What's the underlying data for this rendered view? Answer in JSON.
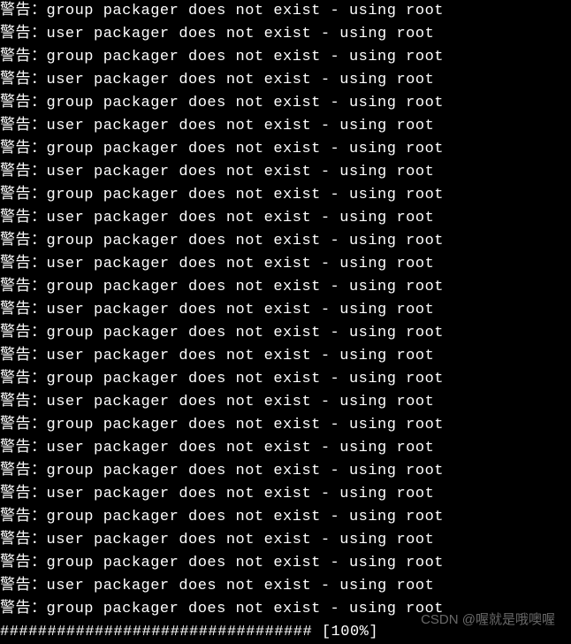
{
  "terminal": {
    "lines": [
      "警告：group packager does not exist - using root",
      "警告：user packager does not exist - using root",
      "警告：group packager does not exist - using root",
      "警告：user packager does not exist - using root",
      "警告：group packager does not exist - using root",
      "警告：user packager does not exist - using root",
      "警告：group packager does not exist - using root",
      "警告：user packager does not exist - using root",
      "警告：group packager does not exist - using root",
      "警告：user packager does not exist - using root",
      "警告：group packager does not exist - using root",
      "警告：user packager does not exist - using root",
      "警告：group packager does not exist - using root",
      "警告：user packager does not exist - using root",
      "警告：group packager does not exist - using root",
      "警告：user packager does not exist - using root",
      "警告：group packager does not exist - using root",
      "警告：user packager does not exist - using root",
      "警告：group packager does not exist - using root",
      "警告：user packager does not exist - using root",
      "警告：group packager does not exist - using root",
      "警告：user packager does not exist - using root",
      "警告：group packager does not exist - using root",
      "警告：user packager does not exist - using root",
      "警告：group packager does not exist - using root",
      "警告：user packager does not exist - using root",
      "警告：group packager does not exist - using root"
    ],
    "progress": "################################# [100%]"
  },
  "watermark": "CSDN @喔就是哦噢喔"
}
